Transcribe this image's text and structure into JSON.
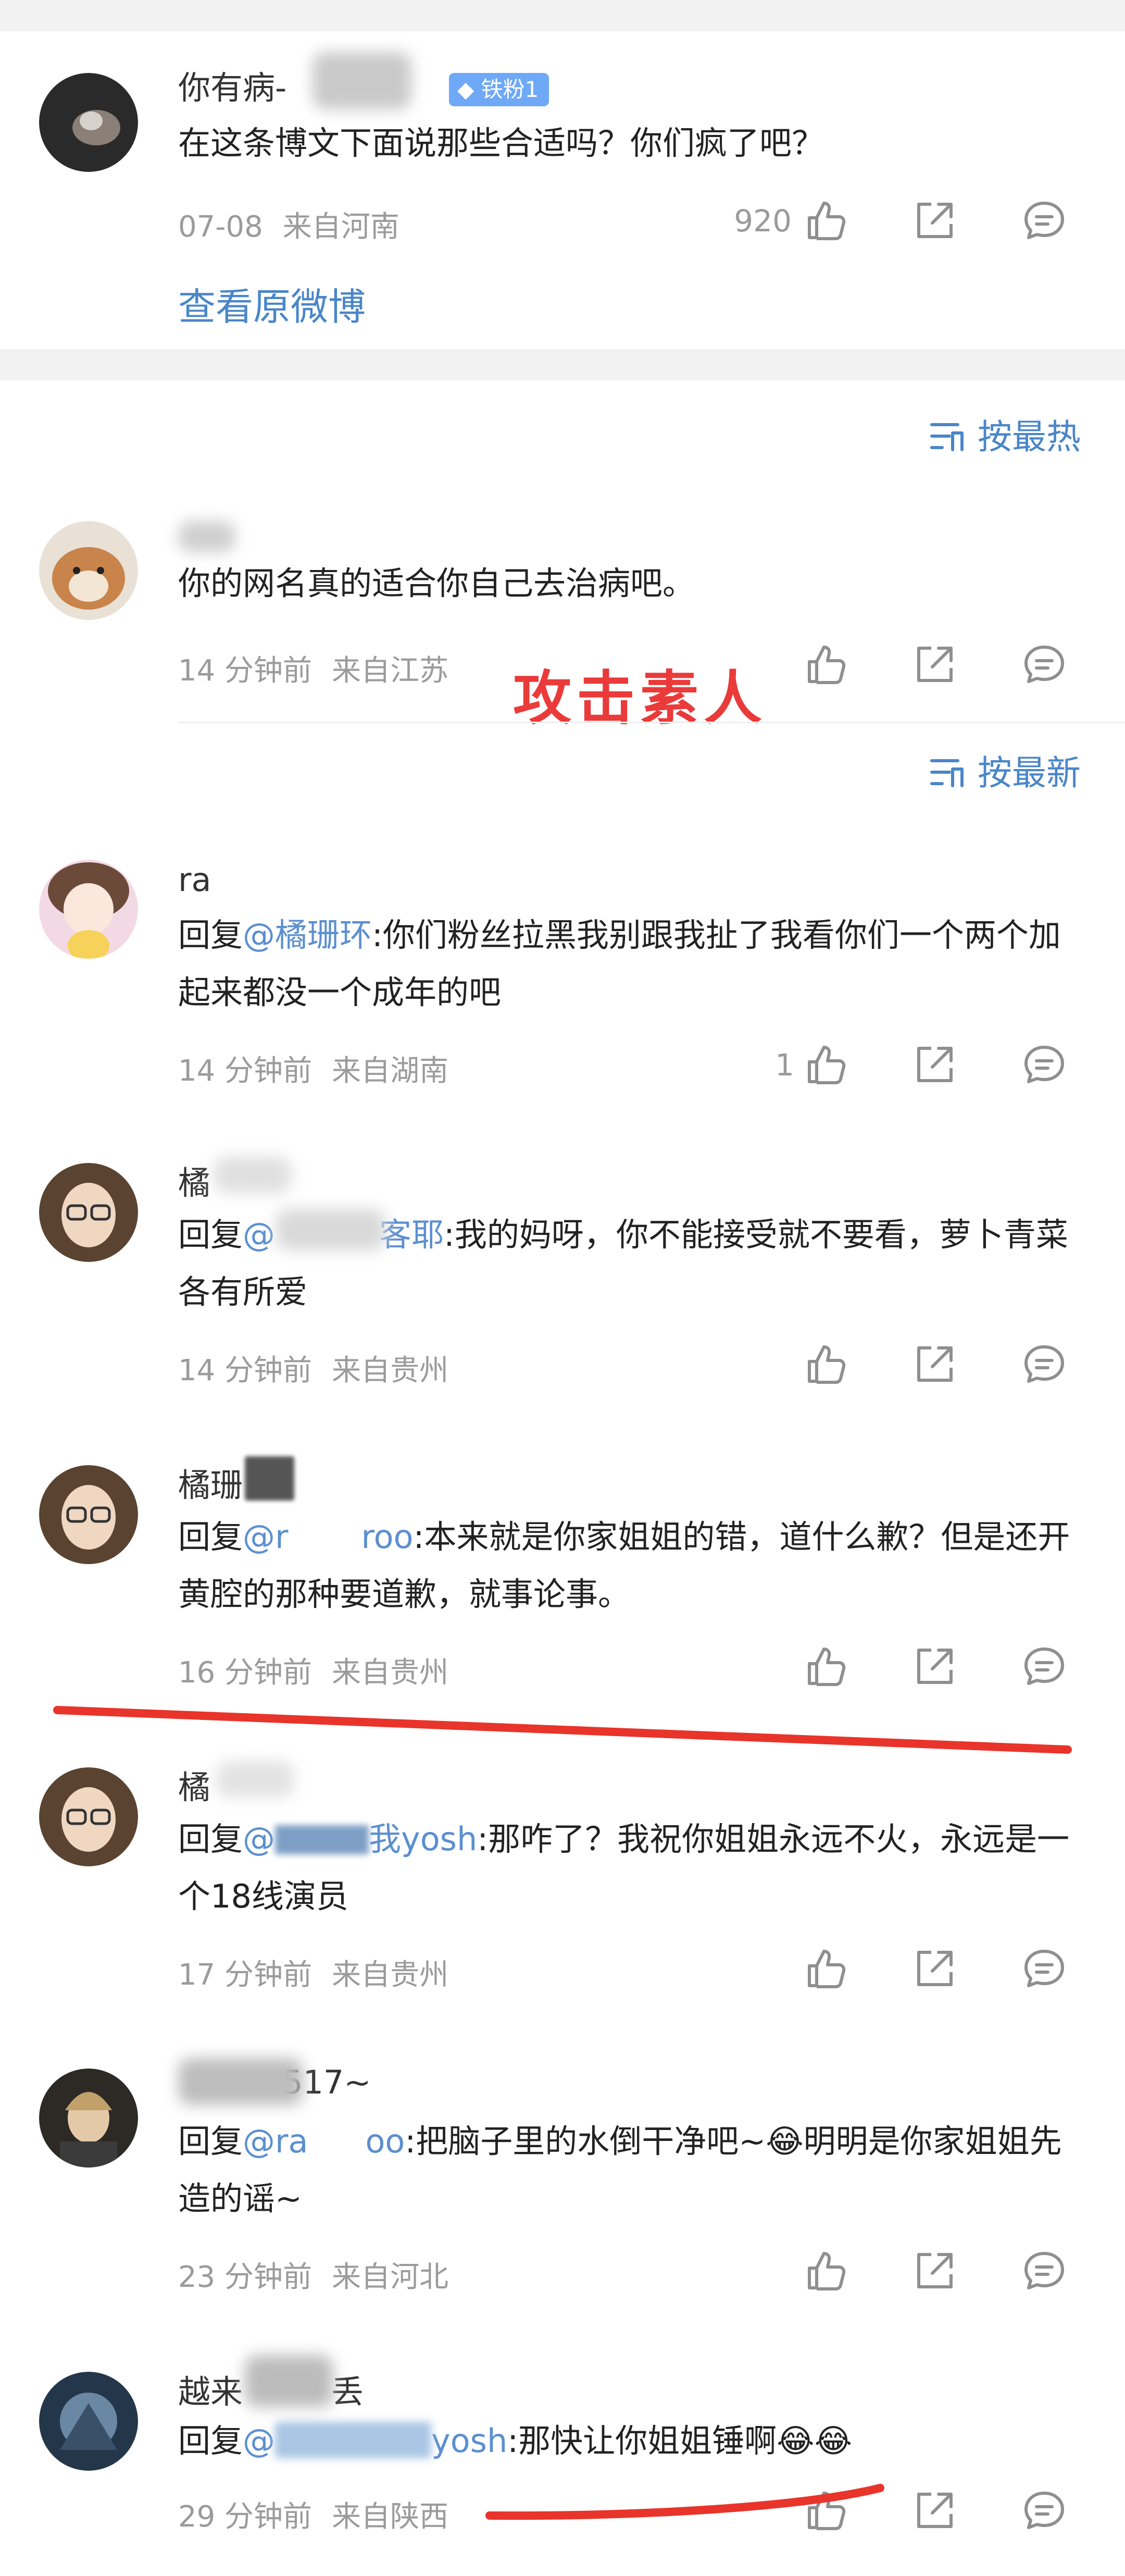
{
  "top_comment": {
    "username": "你有病-",
    "badge": "铁粉1",
    "text": "在这条博文下面说那些合适吗？你们疯了吧？",
    "time": "07-08",
    "location": "来自河南",
    "likes": "920",
    "view_original": "查看原微博"
  },
  "sort_hot": "按最热",
  "sort_new": "按最新",
  "annotation": "攻击素人",
  "comments": [
    {
      "username": "",
      "text_plain": "你的网名真的适合你自己去治病吧。",
      "time": "14 分钟前",
      "location": "来自江苏",
      "likes": ""
    },
    {
      "username": "ra",
      "reply_prefix": "回复",
      "mention": "@橘珊环",
      "text_rest": ":你们粉丝拉黑我别跟我扯了我看你们一个两个加起来都没一个成年的吧",
      "time": "14 分钟前",
      "location": "来自湖南",
      "likes": "1"
    },
    {
      "username": "橘",
      "reply_prefix": "回复",
      "mention": "@",
      "mention_tail": "客耶",
      "text_rest": ":我的妈呀，你不能接受就不要看，萝卜青菜各有所爱",
      "time": "14 分钟前",
      "location": "来自贵州",
      "likes": ""
    },
    {
      "username": "橘珊",
      "reply_prefix": "回复",
      "mention": "@r",
      "mention_tail": "roo",
      "text_rest": ":本来就是你家姐姐的错，道什么歉？但是还开黄腔的那种要道歉，就事论事。",
      "time": "16 分钟前",
      "location": "来自贵州",
      "likes": ""
    },
    {
      "username": "橘",
      "reply_prefix": "回复",
      "mention": "@",
      "mention_tail": "我yosh",
      "text_rest": ":那咋了？我祝你姐姐永远不火，永远是一个18线演员",
      "time": "17 分钟前",
      "location": "来自贵州",
      "likes": ""
    },
    {
      "username": "",
      "username_tail": "517~",
      "reply_prefix": "回复",
      "mention": "@ra",
      "mention_tail": "oo",
      "text_rest": ":把脑子里的水倒干净吧~😂明明是你家姐姐先造的谣~",
      "time": "23 分钟前",
      "location": "来自河北",
      "likes": ""
    },
    {
      "username": "越来",
      "username_tail": "丢",
      "reply_prefix": "回复",
      "mention": "@",
      "mention_tail": "yosh",
      "text_rest": ":那快让你姐姐锤啊😂😂",
      "time": "29 分钟前",
      "location": "来自陕西",
      "likes": ""
    }
  ],
  "colors": {
    "link": "#4a86c8",
    "mention": "#5b8fd0",
    "meta": "#9b9b9b",
    "annotation": "#ea3a3a",
    "badge": "#6ea8f7"
  },
  "icons": [
    "like-icon",
    "share-icon",
    "comment-icon",
    "sort-icon",
    "diamond-icon"
  ]
}
